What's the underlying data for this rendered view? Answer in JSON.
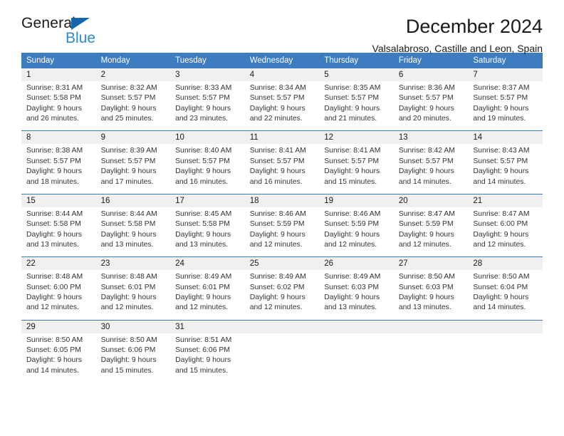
{
  "brand": {
    "name_part1": "General",
    "name_part2": "Blue",
    "accent_color": "#2e8bd0",
    "triangle_color": "#1565ad"
  },
  "header": {
    "title": "December 2024",
    "subtitle": "Valsalabroso, Castille and Leon, Spain"
  },
  "calendar": {
    "header_bg": "#3c7cbf",
    "daynum_bg": "#f0f0f0",
    "weekday_headers": [
      "Sunday",
      "Monday",
      "Tuesday",
      "Wednesday",
      "Thursday",
      "Friday",
      "Saturday"
    ],
    "weeks": [
      {
        "days": [
          {
            "num": "1",
            "sunrise": "Sunrise: 8:31 AM",
            "sunset": "Sunset: 5:58 PM",
            "daylight1": "Daylight: 9 hours",
            "daylight2": "and 26 minutes."
          },
          {
            "num": "2",
            "sunrise": "Sunrise: 8:32 AM",
            "sunset": "Sunset: 5:57 PM",
            "daylight1": "Daylight: 9 hours",
            "daylight2": "and 25 minutes."
          },
          {
            "num": "3",
            "sunrise": "Sunrise: 8:33 AM",
            "sunset": "Sunset: 5:57 PM",
            "daylight1": "Daylight: 9 hours",
            "daylight2": "and 23 minutes."
          },
          {
            "num": "4",
            "sunrise": "Sunrise: 8:34 AM",
            "sunset": "Sunset: 5:57 PM",
            "daylight1": "Daylight: 9 hours",
            "daylight2": "and 22 minutes."
          },
          {
            "num": "5",
            "sunrise": "Sunrise: 8:35 AM",
            "sunset": "Sunset: 5:57 PM",
            "daylight1": "Daylight: 9 hours",
            "daylight2": "and 21 minutes."
          },
          {
            "num": "6",
            "sunrise": "Sunrise: 8:36 AM",
            "sunset": "Sunset: 5:57 PM",
            "daylight1": "Daylight: 9 hours",
            "daylight2": "and 20 minutes."
          },
          {
            "num": "7",
            "sunrise": "Sunrise: 8:37 AM",
            "sunset": "Sunset: 5:57 PM",
            "daylight1": "Daylight: 9 hours",
            "daylight2": "and 19 minutes."
          }
        ]
      },
      {
        "days": [
          {
            "num": "8",
            "sunrise": "Sunrise: 8:38 AM",
            "sunset": "Sunset: 5:57 PM",
            "daylight1": "Daylight: 9 hours",
            "daylight2": "and 18 minutes."
          },
          {
            "num": "9",
            "sunrise": "Sunrise: 8:39 AM",
            "sunset": "Sunset: 5:57 PM",
            "daylight1": "Daylight: 9 hours",
            "daylight2": "and 17 minutes."
          },
          {
            "num": "10",
            "sunrise": "Sunrise: 8:40 AM",
            "sunset": "Sunset: 5:57 PM",
            "daylight1": "Daylight: 9 hours",
            "daylight2": "and 16 minutes."
          },
          {
            "num": "11",
            "sunrise": "Sunrise: 8:41 AM",
            "sunset": "Sunset: 5:57 PM",
            "daylight1": "Daylight: 9 hours",
            "daylight2": "and 16 minutes."
          },
          {
            "num": "12",
            "sunrise": "Sunrise: 8:41 AM",
            "sunset": "Sunset: 5:57 PM",
            "daylight1": "Daylight: 9 hours",
            "daylight2": "and 15 minutes."
          },
          {
            "num": "13",
            "sunrise": "Sunrise: 8:42 AM",
            "sunset": "Sunset: 5:57 PM",
            "daylight1": "Daylight: 9 hours",
            "daylight2": "and 14 minutes."
          },
          {
            "num": "14",
            "sunrise": "Sunrise: 8:43 AM",
            "sunset": "Sunset: 5:57 PM",
            "daylight1": "Daylight: 9 hours",
            "daylight2": "and 14 minutes."
          }
        ]
      },
      {
        "days": [
          {
            "num": "15",
            "sunrise": "Sunrise: 8:44 AM",
            "sunset": "Sunset: 5:58 PM",
            "daylight1": "Daylight: 9 hours",
            "daylight2": "and 13 minutes."
          },
          {
            "num": "16",
            "sunrise": "Sunrise: 8:44 AM",
            "sunset": "Sunset: 5:58 PM",
            "daylight1": "Daylight: 9 hours",
            "daylight2": "and 13 minutes."
          },
          {
            "num": "17",
            "sunrise": "Sunrise: 8:45 AM",
            "sunset": "Sunset: 5:58 PM",
            "daylight1": "Daylight: 9 hours",
            "daylight2": "and 13 minutes."
          },
          {
            "num": "18",
            "sunrise": "Sunrise: 8:46 AM",
            "sunset": "Sunset: 5:59 PM",
            "daylight1": "Daylight: 9 hours",
            "daylight2": "and 12 minutes."
          },
          {
            "num": "19",
            "sunrise": "Sunrise: 8:46 AM",
            "sunset": "Sunset: 5:59 PM",
            "daylight1": "Daylight: 9 hours",
            "daylight2": "and 12 minutes."
          },
          {
            "num": "20",
            "sunrise": "Sunrise: 8:47 AM",
            "sunset": "Sunset: 5:59 PM",
            "daylight1": "Daylight: 9 hours",
            "daylight2": "and 12 minutes."
          },
          {
            "num": "21",
            "sunrise": "Sunrise: 8:47 AM",
            "sunset": "Sunset: 6:00 PM",
            "daylight1": "Daylight: 9 hours",
            "daylight2": "and 12 minutes."
          }
        ]
      },
      {
        "days": [
          {
            "num": "22",
            "sunrise": "Sunrise: 8:48 AM",
            "sunset": "Sunset: 6:00 PM",
            "daylight1": "Daylight: 9 hours",
            "daylight2": "and 12 minutes."
          },
          {
            "num": "23",
            "sunrise": "Sunrise: 8:48 AM",
            "sunset": "Sunset: 6:01 PM",
            "daylight1": "Daylight: 9 hours",
            "daylight2": "and 12 minutes."
          },
          {
            "num": "24",
            "sunrise": "Sunrise: 8:49 AM",
            "sunset": "Sunset: 6:01 PM",
            "daylight1": "Daylight: 9 hours",
            "daylight2": "and 12 minutes."
          },
          {
            "num": "25",
            "sunrise": "Sunrise: 8:49 AM",
            "sunset": "Sunset: 6:02 PM",
            "daylight1": "Daylight: 9 hours",
            "daylight2": "and 12 minutes."
          },
          {
            "num": "26",
            "sunrise": "Sunrise: 8:49 AM",
            "sunset": "Sunset: 6:03 PM",
            "daylight1": "Daylight: 9 hours",
            "daylight2": "and 13 minutes."
          },
          {
            "num": "27",
            "sunrise": "Sunrise: 8:50 AM",
            "sunset": "Sunset: 6:03 PM",
            "daylight1": "Daylight: 9 hours",
            "daylight2": "and 13 minutes."
          },
          {
            "num": "28",
            "sunrise": "Sunrise: 8:50 AM",
            "sunset": "Sunset: 6:04 PM",
            "daylight1": "Daylight: 9 hours",
            "daylight2": "and 14 minutes."
          }
        ]
      },
      {
        "days": [
          {
            "num": "29",
            "sunrise": "Sunrise: 8:50 AM",
            "sunset": "Sunset: 6:05 PM",
            "daylight1": "Daylight: 9 hours",
            "daylight2": "and 14 minutes."
          },
          {
            "num": "30",
            "sunrise": "Sunrise: 8:50 AM",
            "sunset": "Sunset: 6:06 PM",
            "daylight1": "Daylight: 9 hours",
            "daylight2": "and 15 minutes."
          },
          {
            "num": "31",
            "sunrise": "Sunrise: 8:51 AM",
            "sunset": "Sunset: 6:06 PM",
            "daylight1": "Daylight: 9 hours",
            "daylight2": "and 15 minutes."
          },
          {
            "num": "",
            "sunrise": "",
            "sunset": "",
            "daylight1": "",
            "daylight2": ""
          },
          {
            "num": "",
            "sunrise": "",
            "sunset": "",
            "daylight1": "",
            "daylight2": ""
          },
          {
            "num": "",
            "sunrise": "",
            "sunset": "",
            "daylight1": "",
            "daylight2": ""
          },
          {
            "num": "",
            "sunrise": "",
            "sunset": "",
            "daylight1": "",
            "daylight2": ""
          }
        ]
      }
    ]
  }
}
